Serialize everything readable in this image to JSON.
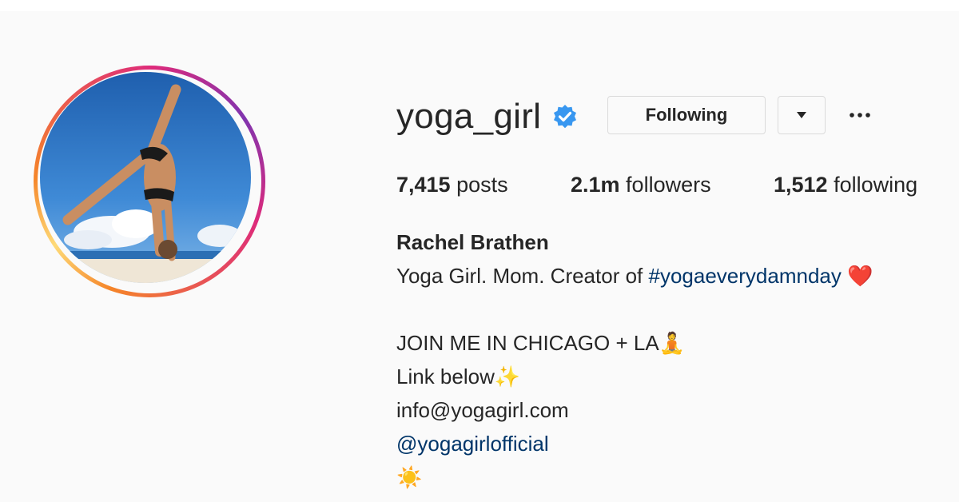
{
  "profile": {
    "username": "yoga_girl",
    "verified_icon": "verified-badge-icon",
    "following_label": "Following",
    "dropdown_icon": "caret-down-icon",
    "more_icon": "more-options-icon",
    "stats": {
      "posts_count": "7,415",
      "posts_label": " posts",
      "followers_count": "2.1m",
      "followers_label": " followers",
      "following_count": "1,512",
      "following_label": " following"
    },
    "full_name": "Rachel Brathen",
    "bio": {
      "line1_text": "Yoga Girl. Mom. Creator of ",
      "line1_hashtag": "#yogaeverydamnday",
      "line1_emoji": "❤️",
      "line2_text": "JOIN ME IN CHICAGO + LA",
      "line2_emoji": "🧘",
      "line3_text": "Link below",
      "line3_emoji": "✨",
      "line4_text": "info@yogagirl.com",
      "line5_mention": "@yogagirlofficial",
      "line6_emoji": "☀️"
    }
  },
  "colors": {
    "background": "#fafafa",
    "text": "#262626",
    "link": "#003569",
    "verified": "#3897f0",
    "button_border": "#dbdbdb"
  }
}
